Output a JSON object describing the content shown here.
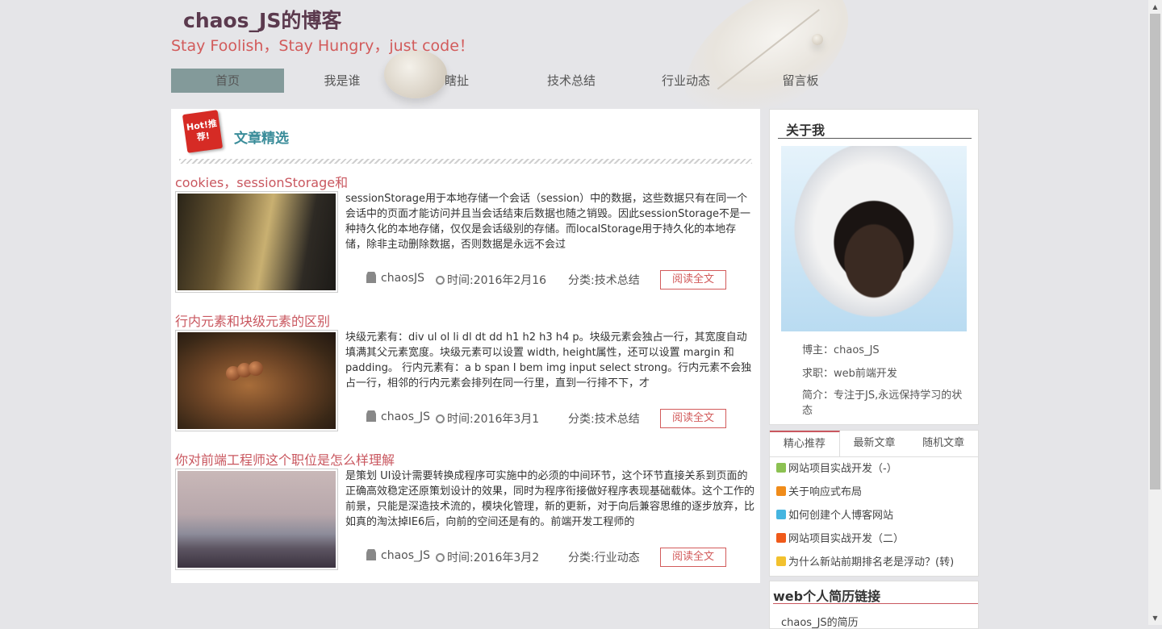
{
  "header": {
    "title": "chaos_JS的博客",
    "slogan": "Stay Foolish，Stay Hungry，just code！"
  },
  "nav": {
    "items": [
      {
        "label": "首页",
        "active": true
      },
      {
        "label": "我是谁"
      },
      {
        "label": "瞎扯"
      },
      {
        "label": "技术总结"
      },
      {
        "label": "行业动态"
      },
      {
        "label": "留言板"
      }
    ]
  },
  "featured": {
    "badge": "Hot!推荐!",
    "title": "文章精选",
    "articles": [
      {
        "title": "cookies，sessionStorage和",
        "summary": "sessionStorage用于本地存储一个会话（session）中的数据，这些数据只有在同一个会话中的页面才能访问并且当会话结束后数据也随之销毁。因此sessionStorage不是一种持久化的本地存储，仅仅是会话级别的存储。而localStorage用于持久化的本地存储，除非主动删除数据，否则数据是永远不会过",
        "author": "chaosJS",
        "time": "时间:2016年2月16",
        "category": "分类:技术总结",
        "read": "阅读全文"
      },
      {
        "title": "行内元素和块级元素的区别",
        "summary": "块级元素有：div ul ol li dl dt dd h1 h2 h3 h4 p。块级元素会独占一行，其宽度自动填满其父元素宽度。块级元素可以设置 width, height属性，还可以设置 margin 和 padding。 行内元素有：a b span I bem img input select strong。行内元素不会独占一行，相邻的行内元素会排列在同一行里，直到一行排不下，才",
        "author": "chaos_JS",
        "time": "时间:2016年3月1",
        "category": "分类:技术总结",
        "read": "阅读全文"
      },
      {
        "title": "你对前端工程师这个职位是怎么样理解",
        "summary": "是策划 UI设计需要转换成程序可实施中的必须的中间环节，这个环节直接关系到页面的正确高效稳定还原策划设计的效果，同时为程序衔接做好程序表现基础载体。这个工作的前景，只能是深造技术流的，模块化管理，新的更新，对于向后兼容思维的逐步放弃，比如真的淘汰掉IE6后，向前的空间还是有的。前端开发工程师的",
        "author": "chaos_JS",
        "time": "时间:2016年3月2",
        "category": "分类:行业动态",
        "read": "阅读全文"
      }
    ]
  },
  "about": {
    "title": "关于我",
    "blogger": "博主：chaos_JS",
    "job": "求职：web前端开发",
    "intro": "简介：专注于JS,永远保持学习的状态"
  },
  "tabs": {
    "labels": [
      "精心推荐",
      "最新文章",
      "随机文章"
    ],
    "active": "精心推荐",
    "items": [
      {
        "text": "网站项目实战开发（-）",
        "color": "#8cc152"
      },
      {
        "text": "关于响应式布局",
        "color": "#f08c1a"
      },
      {
        "text": "如何创建个人博客网站",
        "color": "#45b5e0"
      },
      {
        "text": "网站项目实战开发（二）",
        "color": "#f05a1a"
      },
      {
        "text": "为什么新站前期排名老是浮动？(转)",
        "color": "#f2c12e"
      }
    ]
  },
  "resume": {
    "title": "web个人简历链接",
    "link": "chaos_JS的简历"
  },
  "colors": {
    "accent_red": "#d25b5b",
    "teal": "#3b8d9a",
    "nav_active": "#839a9a"
  }
}
